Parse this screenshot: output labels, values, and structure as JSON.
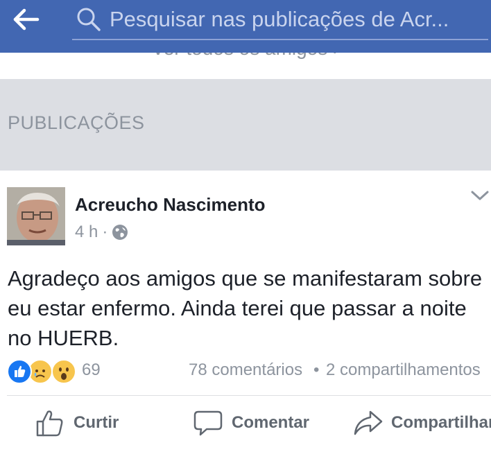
{
  "header": {
    "search_placeholder": "Pesquisar nas publicações de Acr..."
  },
  "friends": {
    "see_all_label": "Ver todos os amigos  ›"
  },
  "section": {
    "title": "PUBLICAÇÕES"
  },
  "post": {
    "author": "Acreucho Nascimento",
    "time": "4 h",
    "separator": "·",
    "privacy_icon": "globe-icon",
    "text": "Agradeço aos amigos que se manifestaram sobre eu estar enfermo. Ainda terei que passar a noite no HUERB.",
    "reactions": {
      "icons": [
        "like-reaction-icon",
        "sad-reaction-icon",
        "wow-reaction-icon"
      ],
      "count": "69"
    },
    "comments": "78 comentários",
    "stats_separator": "•",
    "shares": "2 compartilhamentos"
  },
  "actions": {
    "like_label": "Curtir",
    "comment_label": "Comentar",
    "share_label": "Compartilhar"
  },
  "colors": {
    "header_bg": "#4267b2",
    "section_bg": "#dcdee3",
    "muted_text": "#8d949e",
    "body_text": "#1d2129",
    "action_text": "#606770",
    "like_blue": "#1877f2",
    "reaction_yellow": "#f7c54d"
  }
}
